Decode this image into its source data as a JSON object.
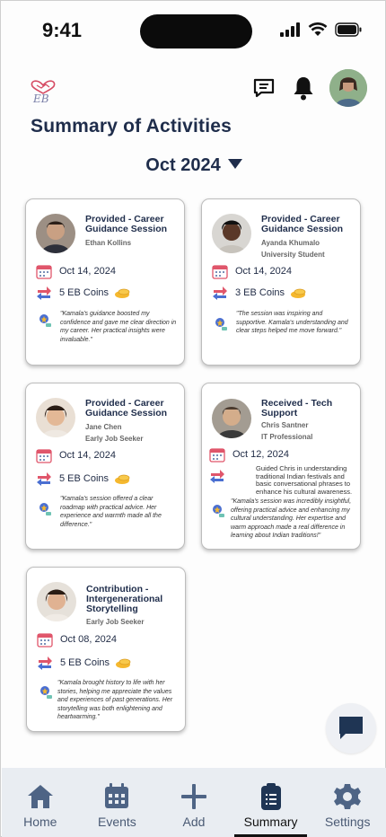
{
  "status": {
    "time": "9:41"
  },
  "header": {
    "logo_text": "EB",
    "title": "Summary of Activities",
    "month": "Oct 2024"
  },
  "cards": [
    {
      "title": "Provided - Career Guidance Session",
      "person": "Ethan Kollins",
      "role": "",
      "date": "Oct 14, 2024",
      "coins": "5 EB Coins",
      "quote": "\"Kamala's guidance boosted my confidence and gave me clear direction in my career. Her practical insights were invaluable.\""
    },
    {
      "title": "Provided - Career Guidance Session",
      "person": "Ayanda Khumalo",
      "role": "University Student",
      "date": "Oct 14, 2024",
      "coins": "3 EB Coins",
      "quote": "\"The session was inspiring and supportive. Kamala's understanding and clear steps helped me move forward.\""
    },
    {
      "title": "Provided - Career Guidance Session",
      "person": "Jane Chen",
      "role": "Early Job Seeker",
      "date": "Oct 14, 2024",
      "coins": "5 EB Coins",
      "quote": "\"Kamala's session offered a clear roadmap with practical advice. Her experience and warmth made all the difference.\""
    },
    {
      "title": "Received - Tech Support",
      "person": "Chris Santner",
      "role": "IT Professional",
      "date": "Oct 12, 2024",
      "description": "Guided Chris in understanding traditional Indian festivals and basic conversational phrases to enhance his cultural awareness.",
      "quote": "\"Kamala's session was incredibly insightful, offering practical advice and enhancing my cultural understanding. Her expertise and warm approach made a real difference in learning about Indian traditions!\""
    },
    {
      "title": "Contribution - Intergenerational Storytelling",
      "person": "",
      "role": "Early Job Seeker",
      "date": "Oct 08, 2024",
      "coins": "5 EB Coins",
      "quote": "\"Kamala brought history to life with her stories, helping me appreciate the values and experiences of past generations. Her storytelling was both enlightening and heartwarming.\""
    }
  ],
  "nav": {
    "items": [
      "Home",
      "Events",
      "Add",
      "Summary",
      "Settings"
    ],
    "active": "Summary"
  },
  "colors": {
    "accent": "#1f2d4b",
    "nav_bg": "#e9edf2",
    "coin": "#f5b82e",
    "calendar": "#e0566b"
  },
  "icons": [
    "calendar-icon",
    "exchange-icon",
    "coin-icon",
    "feedback-icon",
    "chat-icon",
    "bell-icon",
    "home-icon",
    "events-icon",
    "add-icon",
    "summary-icon",
    "settings-icon"
  ]
}
